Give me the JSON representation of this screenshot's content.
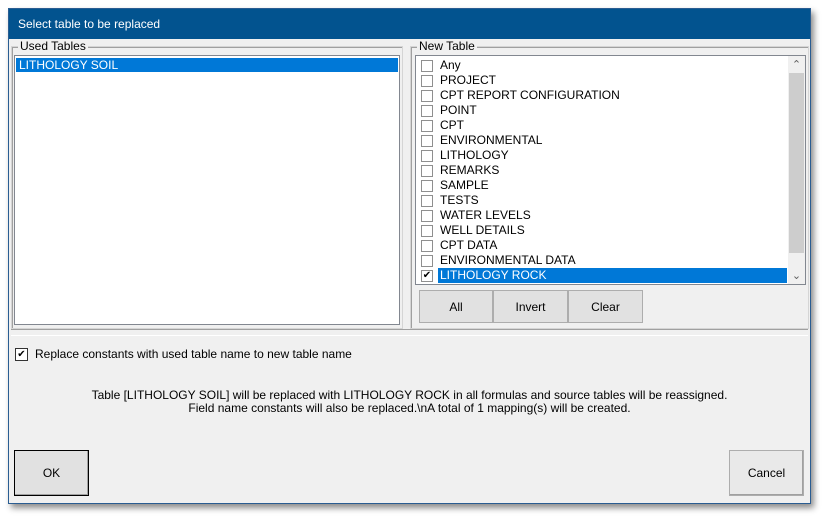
{
  "dialog": {
    "title": "Select table to be replaced"
  },
  "used_tables": {
    "legend": "Used Tables",
    "items": [
      {
        "label": "LITHOLOGY SOIL",
        "selected": true
      }
    ]
  },
  "new_table": {
    "legend": "New Table",
    "items": [
      {
        "label": "Any",
        "checked": false,
        "selected": false
      },
      {
        "label": "PROJECT",
        "checked": false,
        "selected": false
      },
      {
        "label": "CPT REPORT CONFIGURATION",
        "checked": false,
        "selected": false
      },
      {
        "label": "POINT",
        "checked": false,
        "selected": false
      },
      {
        "label": "CPT",
        "checked": false,
        "selected": false
      },
      {
        "label": "ENVIRONMENTAL",
        "checked": false,
        "selected": false
      },
      {
        "label": "LITHOLOGY",
        "checked": false,
        "selected": false
      },
      {
        "label": "REMARKS",
        "checked": false,
        "selected": false
      },
      {
        "label": "SAMPLE",
        "checked": false,
        "selected": false
      },
      {
        "label": "TESTS",
        "checked": false,
        "selected": false
      },
      {
        "label": "WATER LEVELS",
        "checked": false,
        "selected": false
      },
      {
        "label": "WELL DETAILS",
        "checked": false,
        "selected": false
      },
      {
        "label": "CPT DATA",
        "checked": false,
        "selected": false
      },
      {
        "label": "ENVIRONMENTAL DATA",
        "checked": false,
        "selected": false
      },
      {
        "label": "LITHOLOGY ROCK",
        "checked": true,
        "selected": true
      }
    ],
    "scroll_up_icon": "chevron-up",
    "scroll_down_icon": "chevron-down",
    "buttons": {
      "all": "All",
      "invert": "Invert",
      "clear": "Clear"
    }
  },
  "options": {
    "replace_constants_label": "Replace constants with used table name to new table name",
    "replace_constants_checked": true
  },
  "info": {
    "line1": "Table [LITHOLOGY SOIL] will be replaced with LITHOLOGY ROCK in all formulas and source tables will be reassigned.",
    "line2": "Field name constants will also be replaced.\\nA total of 1 mapping(s) will be created."
  },
  "footer": {
    "ok": "OK",
    "cancel": "Cancel"
  }
}
